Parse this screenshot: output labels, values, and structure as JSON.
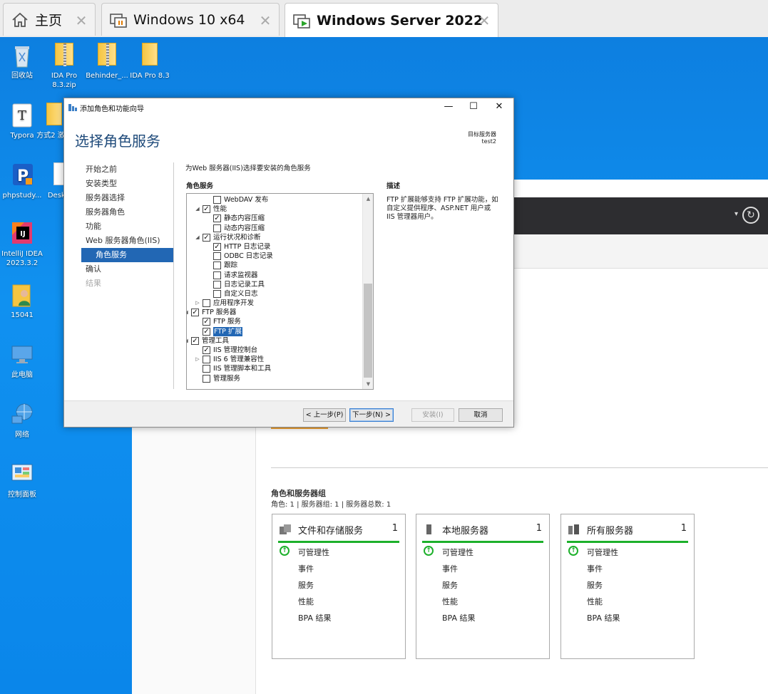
{
  "vm_tabs": [
    {
      "label": "主页",
      "icon": "home-icon",
      "close": "✕"
    },
    {
      "label": "Windows 10 x64",
      "icon": "vm-icon",
      "close": "✕"
    },
    {
      "label": "Windows Server 2022",
      "icon": "vm-running-icon",
      "close": "✕"
    }
  ],
  "desktop_icons": [
    {
      "label": "回收站",
      "icon": "recycle-bin-icon"
    },
    {
      "label": "IDA Pro 8.3.zip",
      "icon": "zip-folder-icon"
    },
    {
      "label": "Behinder_...",
      "icon": "zip-folder-icon"
    },
    {
      "label": "IDA Pro 8.3",
      "icon": "folder-icon"
    },
    {
      "label": "Typora",
      "icon": "typora-icon"
    },
    {
      "label": "方式2 激活",
      "icon": "folder-icon"
    },
    {
      "label": "phpstudy...",
      "icon": "phpstudy-icon"
    },
    {
      "label": "Deskt...",
      "icon": "file-icon"
    },
    {
      "label": "IntelliJ IDEA 2023.3.2",
      "icon": "intellij-icon"
    },
    {
      "label": "15041",
      "icon": "user-folder-icon"
    },
    {
      "label": "此电脑",
      "icon": "computer-icon"
    },
    {
      "label": "网络",
      "icon": "network-icon"
    },
    {
      "label": "控制面板",
      "icon": "control-panel-icon"
    }
  ],
  "server_manager": {
    "role_groups_title": "角色和服务器组",
    "role_groups_sub": "角色: 1 | 服务器组: 1 | 服务器总数: 1",
    "cards": [
      {
        "title": "文件和存储服务",
        "count": "1",
        "icon": "storage-icon",
        "rows": [
          "可管理性",
          "事件",
          "服务",
          "性能",
          "BPA 结果"
        ]
      },
      {
        "title": "本地服务器",
        "count": "1",
        "icon": "server-icon",
        "rows": [
          "可管理性",
          "事件",
          "服务",
          "性能",
          "BPA 结果"
        ]
      },
      {
        "title": "所有服务器",
        "count": "1",
        "icon": "servers-icon",
        "rows": [
          "可管理性",
          "事件",
          "服务",
          "性能",
          "BPA 结果"
        ]
      }
    ],
    "manageability_icon": "↑"
  },
  "wizard": {
    "title": "添加角色和功能向导",
    "heading": "选择角色服务",
    "target_label": "目标服务器",
    "target_value": "test2",
    "window_buttons": {
      "minimize": "—",
      "maximize": "☐",
      "close": "✕"
    },
    "nav": [
      {
        "label": "开始之前",
        "state": "normal"
      },
      {
        "label": "安装类型",
        "state": "normal"
      },
      {
        "label": "服务器选择",
        "state": "normal"
      },
      {
        "label": "服务器角色",
        "state": "normal"
      },
      {
        "label": "功能",
        "state": "normal"
      },
      {
        "label": "Web 服务器角色(IIS)",
        "state": "normal"
      },
      {
        "label": "角色服务",
        "state": "active"
      },
      {
        "label": "确认",
        "state": "normal"
      },
      {
        "label": "结果",
        "state": "disabled"
      }
    ],
    "instruction": "为Web 服务器(IIS)选择要安装的角色服务",
    "roles_label": "角色服务",
    "description_label": "描述",
    "description": "FTP 扩展能够支持 FTP 扩展功能，如自定义提供程序、ASP.NET 用户或 IIS 管理器用户。",
    "tree": [
      {
        "label": "WebDAV 发布",
        "level": 3,
        "checked": false,
        "expander": ""
      },
      {
        "label": "性能",
        "level": 2,
        "checked": true,
        "expander": "◢"
      },
      {
        "label": "静态内容压缩",
        "level": 3,
        "checked": true,
        "expander": ""
      },
      {
        "label": "动态内容压缩",
        "level": 3,
        "checked": false,
        "expander": ""
      },
      {
        "label": "运行状况和诊断",
        "level": 2,
        "checked": true,
        "expander": "◢"
      },
      {
        "label": "HTTP 日志记录",
        "level": 3,
        "checked": true,
        "expander": ""
      },
      {
        "label": "ODBC 日志记录",
        "level": 3,
        "checked": false,
        "expander": ""
      },
      {
        "label": "跟踪",
        "level": 3,
        "checked": false,
        "expander": ""
      },
      {
        "label": "请求监视器",
        "level": 3,
        "checked": false,
        "expander": ""
      },
      {
        "label": "日志记录工具",
        "level": 3,
        "checked": false,
        "expander": ""
      },
      {
        "label": "自定义日志",
        "level": 3,
        "checked": false,
        "expander": ""
      },
      {
        "label": "应用程序开发",
        "level": 2,
        "checked": false,
        "expander": "▷"
      },
      {
        "label": "FTP 服务器",
        "level": 1,
        "checked": true,
        "expander": "◢"
      },
      {
        "label": "FTP 服务",
        "level": 2,
        "checked": true,
        "expander": ""
      },
      {
        "label": "FTP 扩展",
        "level": 2,
        "checked": true,
        "expander": "",
        "selected": true
      },
      {
        "label": "管理工具",
        "level": 1,
        "checked": true,
        "expander": "◢"
      },
      {
        "label": "IIS 管理控制台",
        "level": 2,
        "checked": true,
        "expander": ""
      },
      {
        "label": "IIS 6 管理兼容性",
        "level": 2,
        "checked": false,
        "expander": "▷"
      },
      {
        "label": "IIS 管理脚本和工具",
        "level": 2,
        "checked": false,
        "expander": ""
      },
      {
        "label": "管理服务",
        "level": 2,
        "checked": false,
        "expander": ""
      }
    ],
    "buttons": {
      "prev": "< 上一步(P)",
      "next": "下一步(N) >",
      "install": "安装(I)",
      "cancel": "取消"
    }
  },
  "colors": {
    "desktop": "#0d7fe0",
    "accent": "#2267b4",
    "heading": "#1e4a7a",
    "healthy": "#1db02b"
  }
}
